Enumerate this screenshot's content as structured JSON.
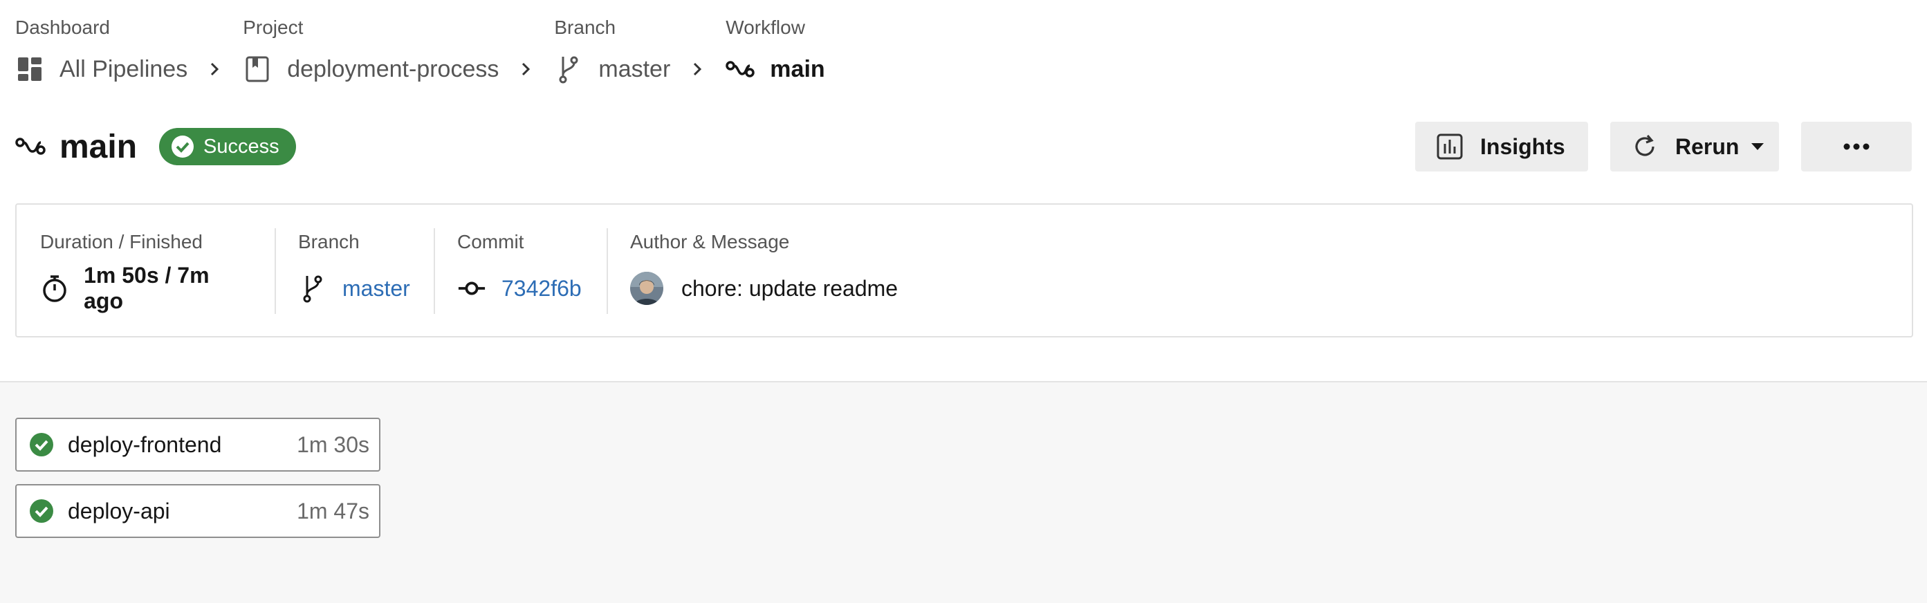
{
  "breadcrumb": [
    {
      "title": "Dashboard",
      "label": "All Pipelines",
      "icon": "dashboard-icon"
    },
    {
      "title": "Project",
      "label": "deployment-process",
      "icon": "project-icon"
    },
    {
      "title": "Branch",
      "label": "master",
      "icon": "branch-icon"
    },
    {
      "title": "Workflow",
      "label": "main",
      "icon": "workflow-icon"
    }
  ],
  "header": {
    "title": "main",
    "status": "Success",
    "actions": {
      "insights": "Insights",
      "rerun": "Rerun",
      "more": "more-icon"
    }
  },
  "info": {
    "duration": {
      "label": "Duration / Finished",
      "value": "1m 50s / 7m ago"
    },
    "branch": {
      "label": "Branch",
      "value": "master"
    },
    "commit": {
      "label": "Commit",
      "value": "7342f6b"
    },
    "author": {
      "label": "Author & Message",
      "value": "chore: update readme"
    }
  },
  "jobs": [
    {
      "name": "deploy-frontend",
      "duration": "1m 30s",
      "status": "success"
    },
    {
      "name": "deploy-api",
      "duration": "1m 47s",
      "status": "success"
    }
  ],
  "colors": {
    "success": "#3b8b44",
    "link": "#2d6db5"
  }
}
